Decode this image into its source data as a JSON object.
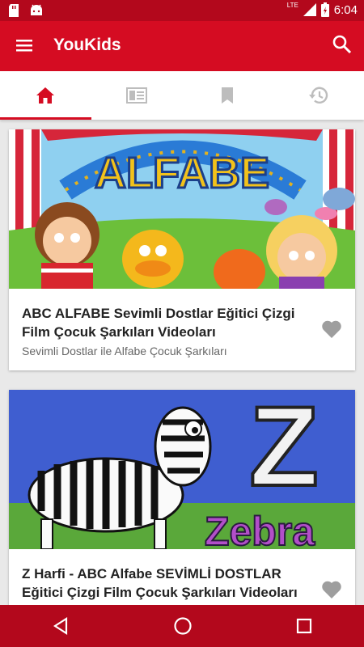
{
  "status": {
    "time": "6:04",
    "network": "LTE"
  },
  "app": {
    "title": "YouKids"
  },
  "tabs": [
    {
      "name": "home",
      "active": true
    },
    {
      "name": "playlist",
      "active": false
    },
    {
      "name": "bookmarks",
      "active": false
    },
    {
      "name": "history",
      "active": false
    }
  ],
  "videos": [
    {
      "title": "ABC ALFABE Sevimli Dostlar Eğitici Çizgi Film Çocuk Şarkıları Videoları",
      "subtitle": "Sevimli Dostlar ile Alfabe Çocuk Şarkıları",
      "thumb_text": "ALFABE"
    },
    {
      "title": "Z Harfi - ABC Alfabe SEVİMLİ DOSTLAR Eğitici Çizgi Film Çocuk Şarkıları Videoları",
      "subtitle": "",
      "thumb_text": "Zebra",
      "thumb_letter": "Z"
    }
  ],
  "colors": {
    "primary": "#d50c22",
    "primary_dark": "#b3081c",
    "inactive_icon": "#bdbdbd",
    "heart": "#9e9e9e"
  }
}
